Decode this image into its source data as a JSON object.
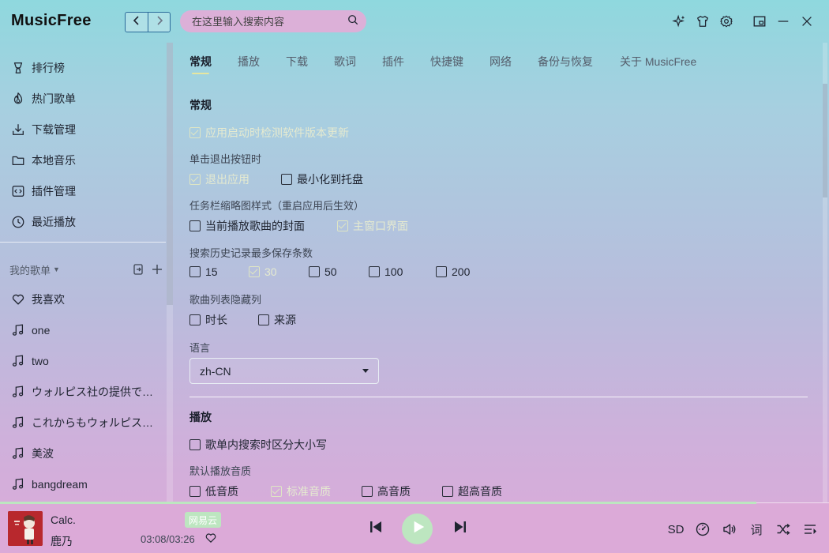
{
  "app": {
    "title": "MusicFree",
    "accent_color": "#bde6c0"
  },
  "header": {
    "back_icon": "chevron-left-icon",
    "forward_icon": "chevron-right-icon",
    "search_placeholder": "在这里输入搜索内容",
    "search_icon": "search-icon",
    "icons": [
      "sparkle-icon",
      "tshirt-icon",
      "gear-icon",
      "mini-mode-icon",
      "minimize-icon",
      "close-icon"
    ]
  },
  "sidebar": {
    "menu": [
      {
        "label": "排行榜",
        "icon": "trophy-icon"
      },
      {
        "label": "热门歌单",
        "icon": "fire-icon"
      },
      {
        "label": "下载管理",
        "icon": "download-icon"
      },
      {
        "label": "本地音乐",
        "icon": "folder-icon"
      },
      {
        "label": "插件管理",
        "icon": "plugin-icon"
      },
      {
        "label": "最近播放",
        "icon": "clock-icon"
      }
    ],
    "my_lists_title": "我的歌单",
    "playlists": [
      {
        "label": "我喜欢",
        "icon": "heart-icon"
      },
      {
        "label": "one",
        "icon": "music-note-icon"
      },
      {
        "label": "two",
        "icon": "music-note-icon"
      },
      {
        "label": "ウォルピス社の提供でお...",
        "icon": "music-note-icon"
      },
      {
        "label": "これからもウォルピス社...",
        "icon": "music-note-icon"
      },
      {
        "label": "美波",
        "icon": "music-note-icon"
      },
      {
        "label": "bangdream",
        "icon": "music-note-icon"
      }
    ]
  },
  "settings": {
    "tabs": [
      "常规",
      "播放",
      "下载",
      "歌词",
      "插件",
      "快捷键",
      "网络",
      "备份与恢复",
      "关于 MusicFree"
    ],
    "active_tab": "常规",
    "general": {
      "title": "常规",
      "check_update": {
        "label": "应用启动时检测软件版本更新",
        "checked": true
      },
      "exit_behavior": {
        "label": "单击退出按钮时",
        "options": [
          {
            "label": "退出应用",
            "checked": true
          },
          {
            "label": "最小化到托盘",
            "checked": false
          }
        ]
      },
      "taskbar_thumb": {
        "label": "任务栏缩略图样式（重启应用后生效）",
        "options": [
          {
            "label": "当前播放歌曲的封面",
            "checked": false
          },
          {
            "label": "主窗口界面",
            "checked": true
          }
        ]
      },
      "search_history": {
        "label": "搜索历史记录最多保存条数",
        "options": [
          {
            "label": "15",
            "checked": false
          },
          {
            "label": "30",
            "checked": true
          },
          {
            "label": "50",
            "checked": false
          },
          {
            "label": "100",
            "checked": false
          },
          {
            "label": "200",
            "checked": false
          }
        ]
      },
      "hide_columns": {
        "label": "歌曲列表隐藏列",
        "options": [
          {
            "label": "时长",
            "checked": false
          },
          {
            "label": "来源",
            "checked": false
          }
        ]
      },
      "language": {
        "label": "语言",
        "value": "zh-CN"
      }
    },
    "playback": {
      "title": "播放",
      "case_sensitive": {
        "label": "歌单内搜索时区分大小写",
        "checked": false
      },
      "default_quality": {
        "label": "默认播放音质",
        "options": [
          {
            "label": "低音质",
            "checked": false
          },
          {
            "label": "标准音质",
            "checked": true
          },
          {
            "label": "高音质",
            "checked": false
          },
          {
            "label": "超高音质",
            "checked": false
          }
        ]
      }
    }
  },
  "player": {
    "title": "Calc.",
    "artist": "鹿乃",
    "source": "网易云",
    "time": "03:08/03:26",
    "progress": 0.912,
    "quality": "SD",
    "lyric_label": "词"
  }
}
